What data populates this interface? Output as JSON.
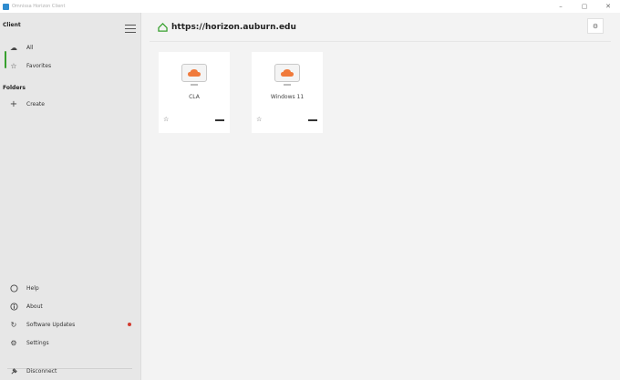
{
  "window": {
    "title": "Omnissa Horizon Client",
    "controls": [
      "–",
      "▢",
      "✕"
    ]
  },
  "sidebar": {
    "section_main": "Client",
    "items": [
      {
        "label": "All",
        "icon": "cloud-icon",
        "glyph": "☁"
      },
      {
        "label": "Favorites",
        "icon": "star-icon",
        "glyph": "☆"
      }
    ],
    "section_folders": "Folders",
    "create_label": "Create",
    "bottom_items": [
      {
        "label": "Help",
        "icon": "help-icon",
        "glyph": "?"
      },
      {
        "label": "About",
        "icon": "info-icon",
        "glyph": "i"
      },
      {
        "label": "Software Updates",
        "icon": "refresh-icon",
        "glyph": "↻"
      },
      {
        "label": "Settings",
        "icon": "gear-icon",
        "glyph": "⚙"
      }
    ],
    "disconnect_label": "Disconnect"
  },
  "header": {
    "server_url": "https://horizon.auburn.edu"
  },
  "desktops": [
    {
      "name": "CLA"
    },
    {
      "name": "Windows 11"
    }
  ],
  "colors": {
    "accent": "#37a02e",
    "cloud": "#f07a3b",
    "alert": "#d23b2f"
  }
}
